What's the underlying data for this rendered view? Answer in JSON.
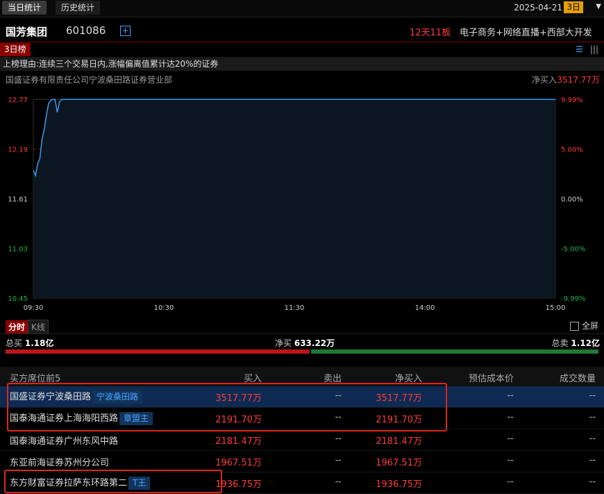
{
  "top_tabs": {
    "today": "当日统计",
    "history": "历史统计"
  },
  "date": "2025-04-21",
  "days_badge": "3日",
  "stock": {
    "name": "国芳集团",
    "code": "601086",
    "streak": "12天11板",
    "concepts": "电子商务+网络直播+西部大开发"
  },
  "board_tag": "3日榜",
  "reason": "上榜理由:连续三个交易日内,涨幅偏离值累计达20%的证券",
  "broker": {
    "name": "国盛证券有限责任公司宁波桑田路证券营业部",
    "net_label": "净买入",
    "net_value": "3517.77万"
  },
  "chart_data": {
    "type": "line",
    "x_ticks": [
      "09:30",
      "10:30",
      "11:30",
      "14:00",
      "15:00"
    ],
    "y_ticks_left": [
      "12.77",
      "12.19",
      "11.61",
      "11.03",
      "10.45"
    ],
    "y_ticks_right": [
      "9.99%",
      "5.00%",
      "0.00%",
      "-5.00%",
      "-9.99%"
    ],
    "ylim": [
      10.45,
      12.77
    ],
    "total_minutes": 240,
    "series": [
      {
        "points": [
          [
            0,
            11.94
          ],
          [
            1,
            11.88
          ],
          [
            2,
            12.02
          ],
          [
            3,
            12.08
          ],
          [
            4,
            12.3
          ],
          [
            5,
            12.42
          ],
          [
            6,
            12.58
          ],
          [
            7,
            12.72
          ],
          [
            8,
            12.76
          ],
          [
            9,
            12.77
          ],
          [
            10,
            12.77
          ],
          [
            11,
            12.62
          ],
          [
            12,
            12.74
          ],
          [
            13,
            12.77
          ],
          [
            240,
            12.77
          ]
        ]
      }
    ],
    "grid": true,
    "colors": {
      "line": "#3d9bf0",
      "fill": "#0b1620",
      "grid": "#7a1818",
      "axis_up": "#ff3b3b",
      "axis_down": "#21b34b",
      "axis_mid": "#ccc"
    }
  },
  "subtabs": {
    "active": "分时",
    "inactive": "K线"
  },
  "fullscreen": "全屏",
  "summary": {
    "buy_label": "总买",
    "buy_value": "1.18亿",
    "net_label": "净买",
    "net_value": "633.22万",
    "sell_label": "总卖",
    "sell_value": "1.12亿"
  },
  "table": {
    "headers": [
      "买方席位前5",
      "买入",
      "卖出",
      "净买入",
      "预估成本价",
      "成交数量"
    ],
    "rows": [
      {
        "name": "国盛证券宁波桑田路",
        "alias": "宁波桑田路",
        "buy": "3517.77万",
        "sell": "--",
        "net": "3517.77万",
        "cost": "--",
        "qty": "--"
      },
      {
        "name": "国泰海通证券上海海阳西路",
        "alias": "章盟主",
        "buy": "2191.70万",
        "sell": "--",
        "net": "2191.70万",
        "cost": "--",
        "qty": "--"
      },
      {
        "name": "国泰海通证券广州东风中路",
        "alias": "",
        "buy": "2181.47万",
        "sell": "--",
        "net": "2181.47万",
        "cost": "--",
        "qty": "--"
      },
      {
        "name": "东亚前海证券苏州分公司",
        "alias": "",
        "buy": "1967.51万",
        "sell": "--",
        "net": "1967.51万",
        "cost": "--",
        "qty": "--"
      },
      {
        "name": "东方财富证券拉萨东环路第二",
        "alias": "T王",
        "buy": "1936.75万",
        "sell": "--",
        "net": "1936.75万",
        "cost": "--",
        "qty": "--"
      }
    ]
  },
  "colors": {
    "accent": "#4aa3ff",
    "up": "#ff3b3b",
    "down": "#21b34b",
    "selected_row": "#0f2a52",
    "highlight": "#e0251b"
  }
}
